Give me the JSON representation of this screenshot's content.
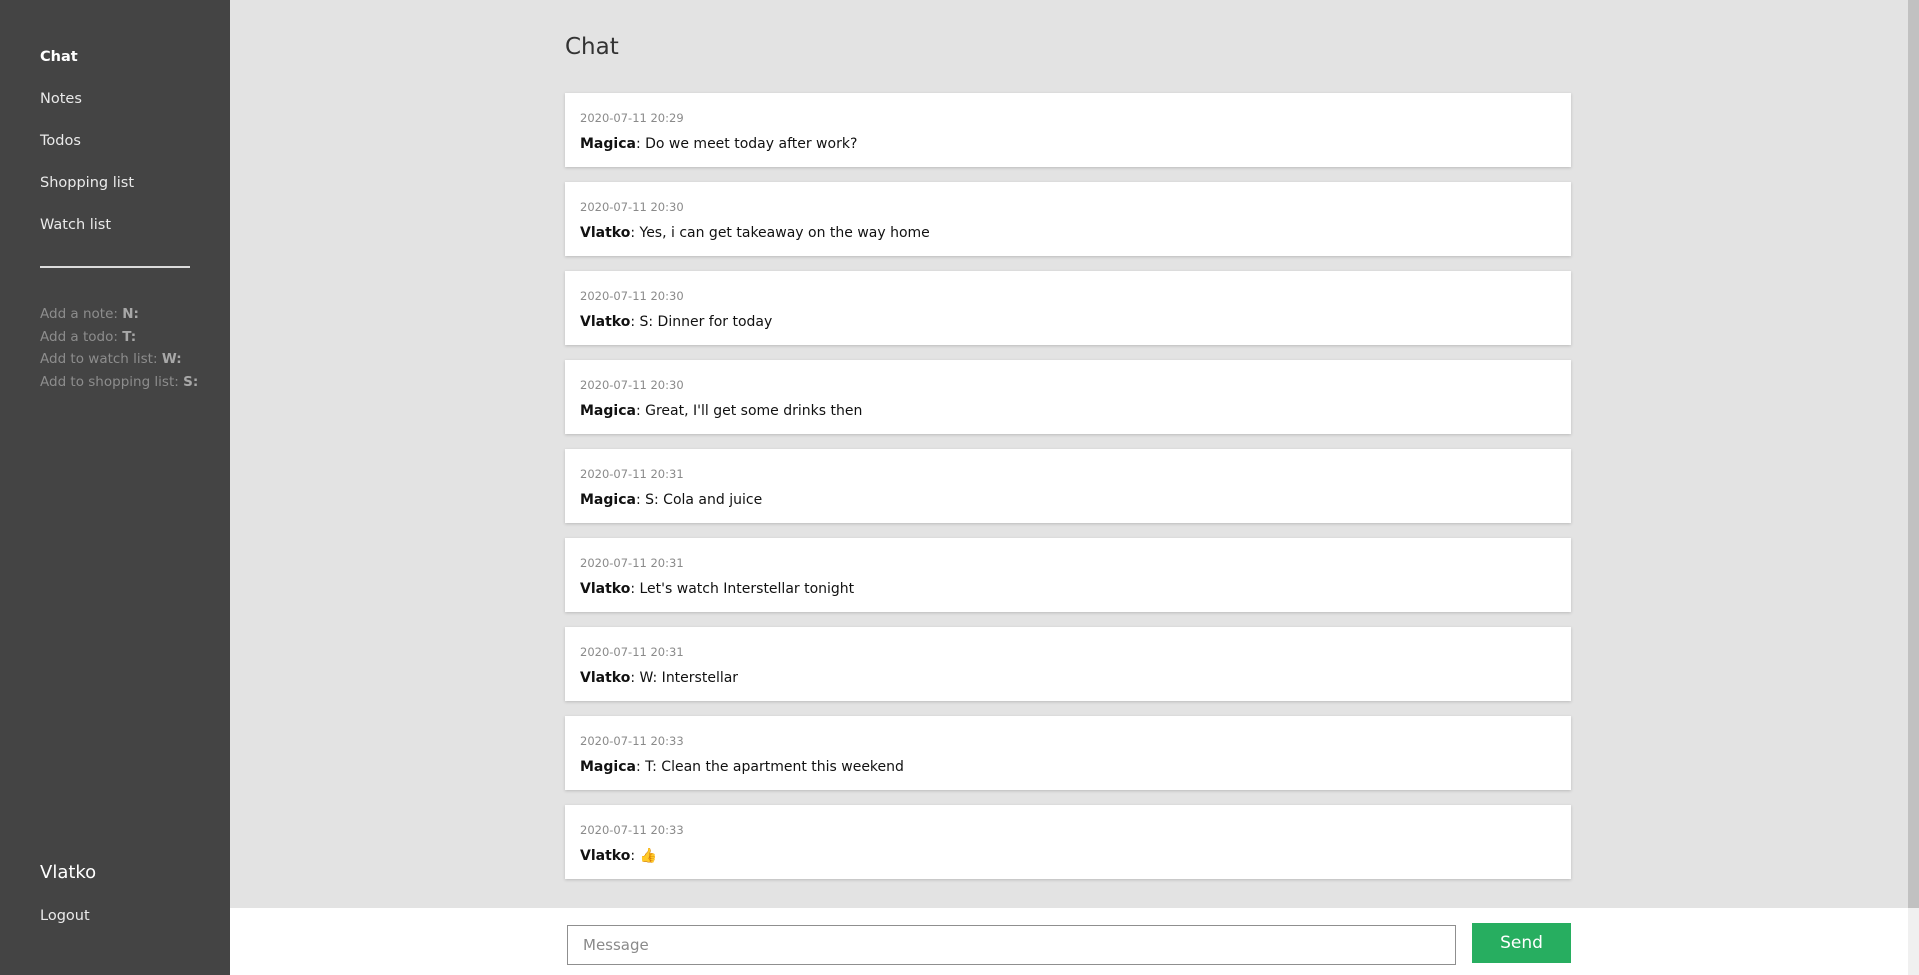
{
  "sidebar": {
    "nav": [
      {
        "label": "Chat",
        "active": true
      },
      {
        "label": "Notes",
        "active": false
      },
      {
        "label": "Todos",
        "active": false
      },
      {
        "label": "Shopping list",
        "active": false
      },
      {
        "label": "Watch list",
        "active": false
      }
    ],
    "hints": [
      {
        "text": "Add a note: ",
        "key": "N:"
      },
      {
        "text": "Add a todo: ",
        "key": "T:"
      },
      {
        "text": "Add to watch list: ",
        "key": "W:"
      },
      {
        "text": "Add to shopping list: ",
        "key": "S:"
      }
    ],
    "username": "Vlatko",
    "logout_label": "Logout"
  },
  "main": {
    "title": "Chat",
    "messages": [
      {
        "time": "2020-07-11 20:29",
        "author": "Magica",
        "text": ": Do we meet today after work?"
      },
      {
        "time": "2020-07-11 20:30",
        "author": "Vlatko",
        "text": ": Yes, i can get takeaway on the way home"
      },
      {
        "time": "2020-07-11 20:30",
        "author": "Vlatko",
        "text": ": S: Dinner for today"
      },
      {
        "time": "2020-07-11 20:30",
        "author": "Magica",
        "text": ": Great, I'll get some drinks then"
      },
      {
        "time": "2020-07-11 20:31",
        "author": "Magica",
        "text": ": S: Cola and juice"
      },
      {
        "time": "2020-07-11 20:31",
        "author": "Vlatko",
        "text": ": Let's watch Interstellar tonight"
      },
      {
        "time": "2020-07-11 20:31",
        "author": "Vlatko",
        "text": ": W: Interstellar"
      },
      {
        "time": "2020-07-11 20:33",
        "author": "Magica",
        "text": ": T: Clean the apartment this weekend"
      },
      {
        "time": "2020-07-11 20:33",
        "author": "Vlatko",
        "text": ": 👍"
      }
    ]
  },
  "composer": {
    "placeholder": "Message",
    "value": "",
    "send_label": "Send"
  },
  "colors": {
    "sidebar_bg": "#444444",
    "main_bg": "#e3e3e3",
    "send_button": "#27ae60"
  }
}
